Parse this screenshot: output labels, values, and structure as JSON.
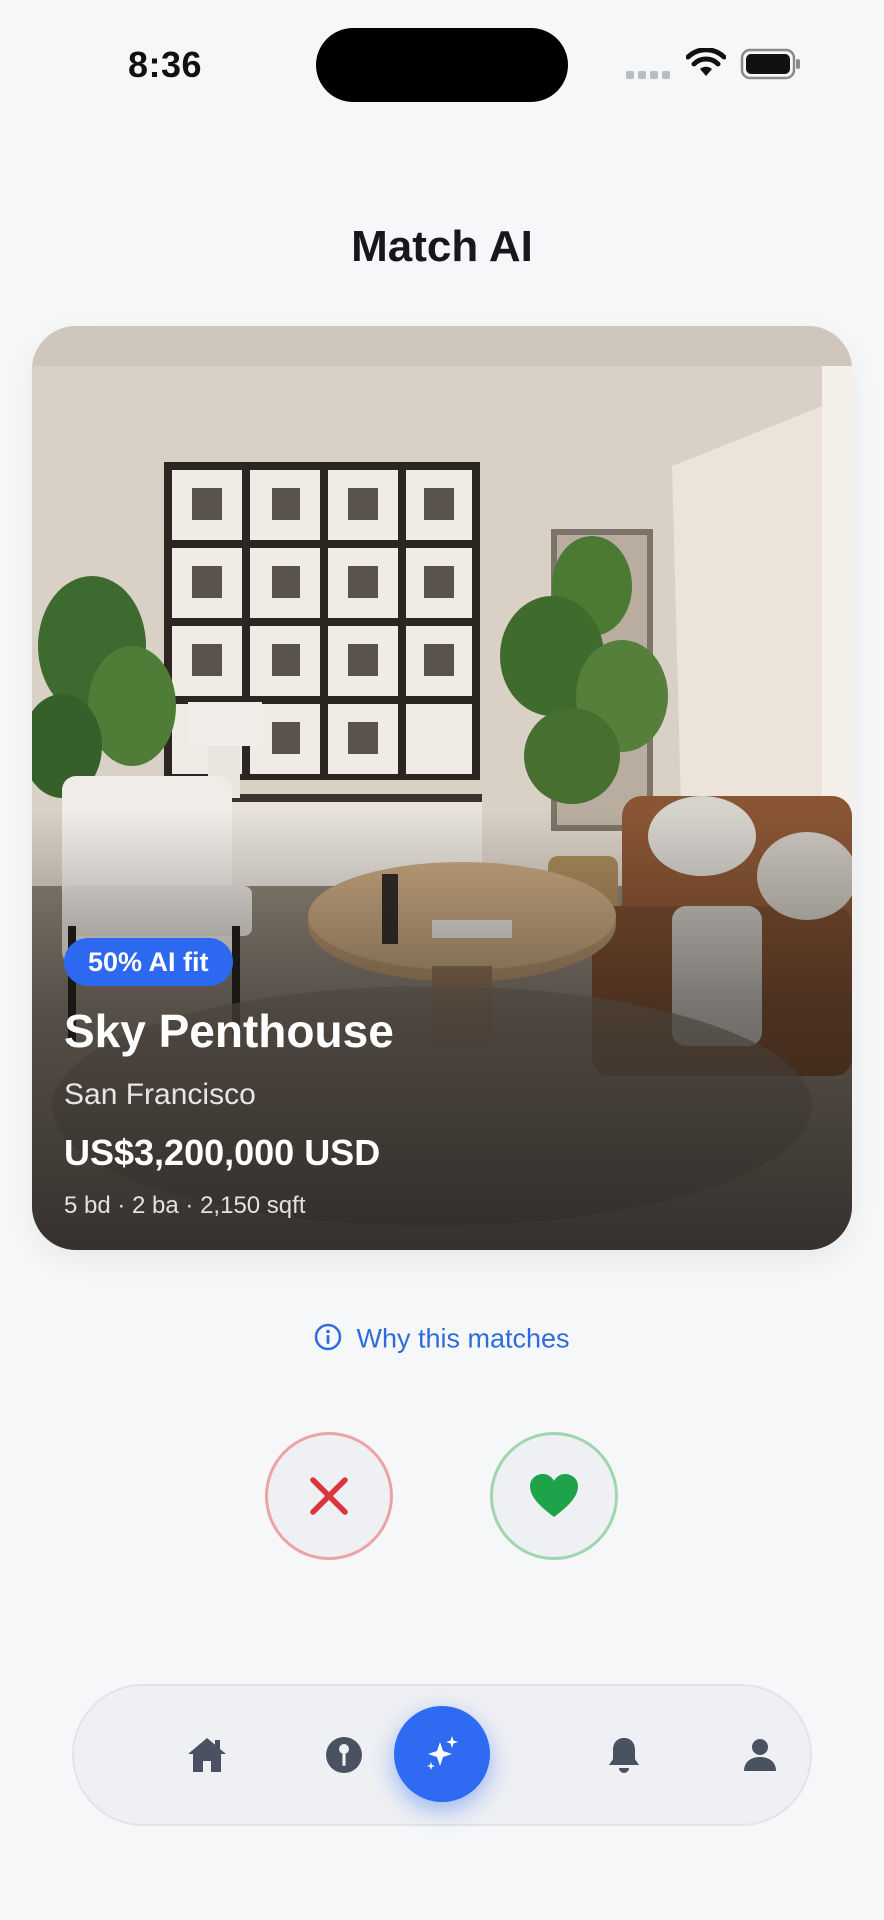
{
  "status_bar": {
    "time": "8:36"
  },
  "header": {
    "title": "Match AI"
  },
  "listing": {
    "badge": "50% AI fit",
    "name": "Sky Penthouse",
    "city": "San Francisco",
    "price": "US$3,200,000 USD",
    "specs": "5 bd · 2 ba · 2,150 sqft",
    "ai_fit_percent": 50
  },
  "why_match": {
    "label": "Why this matches",
    "icon": "info-icon"
  },
  "actions": {
    "reject_icon": "close-icon",
    "like_icon": "heart-icon"
  },
  "tab_bar": {
    "items": [
      {
        "name": "home",
        "icon": "home-icon"
      },
      {
        "name": "explore",
        "icon": "location-pin-icon"
      },
      {
        "name": "match",
        "icon": "sparkles-icon",
        "active": true
      },
      {
        "name": "alerts",
        "icon": "bell-icon"
      },
      {
        "name": "profile",
        "icon": "person-icon"
      }
    ]
  },
  "colors": {
    "accent": "#2E6BF2",
    "reject": "#D9363E",
    "like": "#1FA34A",
    "background": "#F6F7F9"
  }
}
